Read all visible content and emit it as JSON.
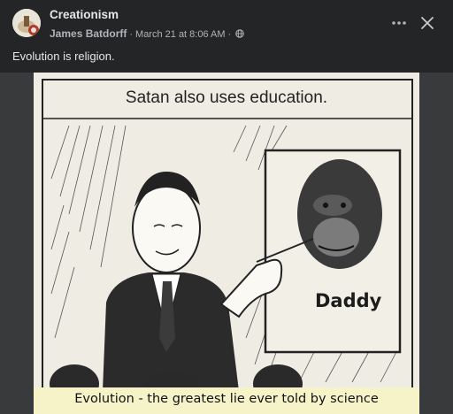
{
  "post": {
    "group_name": "Creationism",
    "author": "James Batdorff",
    "separator": "·",
    "timestamp": "March 21 at 8:06 AM",
    "text": "Evolution is religion."
  },
  "header_actions": {
    "more_icon": "more-horizontal-icon",
    "close_icon": "close-icon",
    "privacy_icon": "globe-icon"
  },
  "image": {
    "top_caption": "Satan also uses education.",
    "board_label": "Daddy",
    "bottom_caption": "Evolution - the greatest lie ever told by science"
  },
  "colors": {
    "background": "#242526",
    "text_primary": "#e4e6eb",
    "text_secondary": "#b0b3b8",
    "caption_band": "#f6f3c9"
  }
}
